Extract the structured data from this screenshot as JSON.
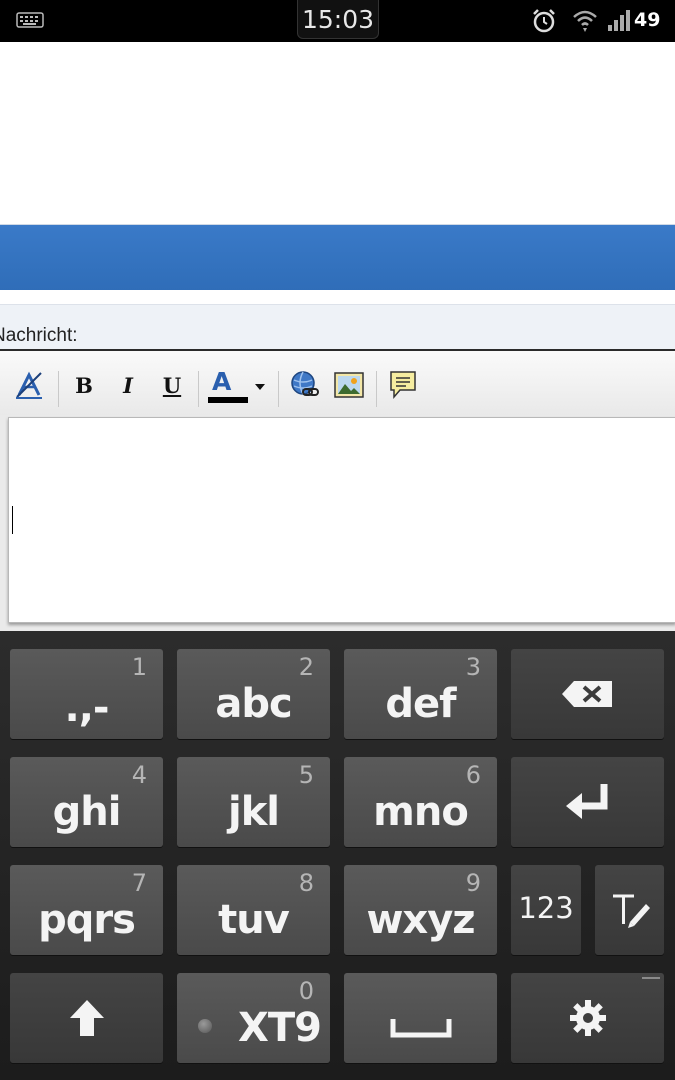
{
  "status_bar": {
    "time": "15:03",
    "battery": "49",
    "icons": [
      "keyboard-icon",
      "alarm-icon",
      "wifi-icon",
      "signal-icon"
    ]
  },
  "form": {
    "message_label": "Nachricht:"
  },
  "toolbar": {
    "buttons": [
      "remove-format-icon",
      "bold-button",
      "italic-button",
      "underline-button",
      "font-color-button",
      "link-icon",
      "image-icon",
      "quote-icon"
    ],
    "bold": "B",
    "italic": "I",
    "underline": "U",
    "font_color": "A",
    "font_color_value": "#000000"
  },
  "keyboard": {
    "keys": [
      {
        "label": ".,-",
        "num": "1"
      },
      {
        "label": "abc",
        "num": "2"
      },
      {
        "label": "def",
        "num": "3"
      },
      {
        "label": "ghi",
        "num": "4"
      },
      {
        "label": "jkl",
        "num": "5"
      },
      {
        "label": "mno",
        "num": "6"
      },
      {
        "label": "pqrs",
        "num": "7"
      },
      {
        "label": "tuv",
        "num": "8"
      },
      {
        "label": "wxyz",
        "num": "9"
      },
      {
        "label": "XT9",
        "num": "0"
      }
    ],
    "mode_key": "123",
    "icons": [
      "backspace-icon",
      "enter-icon",
      "handwriting-icon",
      "shift-icon",
      "space-icon",
      "settings-icon"
    ]
  },
  "colors": {
    "header_blue": "#2f6db8",
    "keyboard_bg": "#222222"
  }
}
